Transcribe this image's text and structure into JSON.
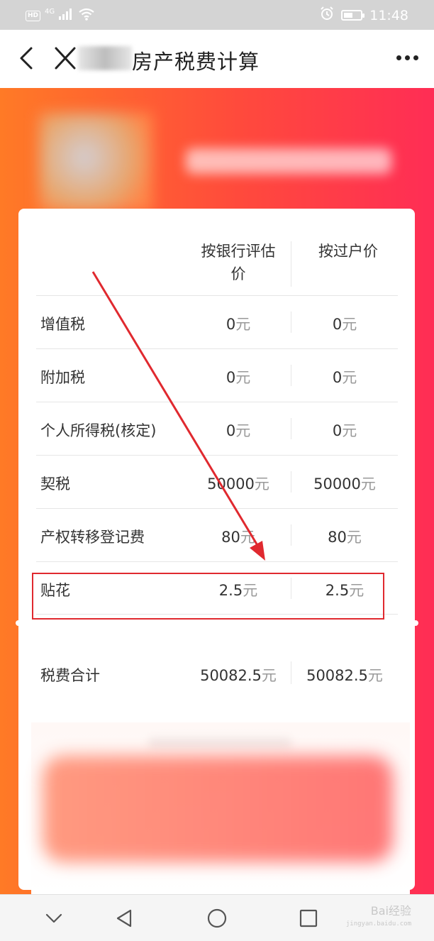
{
  "status_bar": {
    "time": "11:48",
    "network": "4G",
    "hd": "HD",
    "battery_level": 0.55
  },
  "nav": {
    "title": "房产税费计算"
  },
  "table": {
    "headers": {
      "bank_line1": "按银行评估",
      "bank_line2": "价",
      "transfer": "按过户价"
    },
    "rows": [
      {
        "label": "增值税",
        "bank_value": "0",
        "transfer_value": "0",
        "unit": "元"
      },
      {
        "label": "附加税",
        "bank_value": "0",
        "transfer_value": "0",
        "unit": "元"
      },
      {
        "label": "个人所得税(核定)",
        "bank_value": "0",
        "transfer_value": "0",
        "unit": "元"
      },
      {
        "label": "契税",
        "bank_value": "50000",
        "transfer_value": "50000",
        "unit": "元"
      },
      {
        "label": "产权转移登记费",
        "bank_value": "80",
        "transfer_value": "80",
        "unit": "元"
      },
      {
        "label": "贴花",
        "bank_value": "2.5",
        "transfer_value": "2.5",
        "unit": "元"
      }
    ],
    "total": {
      "label": "税费合计",
      "bank_value": "50082.5",
      "transfer_value": "50082.5",
      "unit": "元"
    }
  },
  "watermark": {
    "line1": "Bai经验",
    "line2": "jingyan.baidu.com"
  },
  "colors": {
    "gradient_start": "#ff7a26",
    "gradient_end": "#ff2d55",
    "annotation_red": "#e0292f"
  },
  "icons": {
    "back": "chevron-left-icon",
    "close": "close-icon",
    "more": "more-horizontal-icon",
    "wifi": "wifi-icon",
    "alarm": "alarm-icon"
  }
}
